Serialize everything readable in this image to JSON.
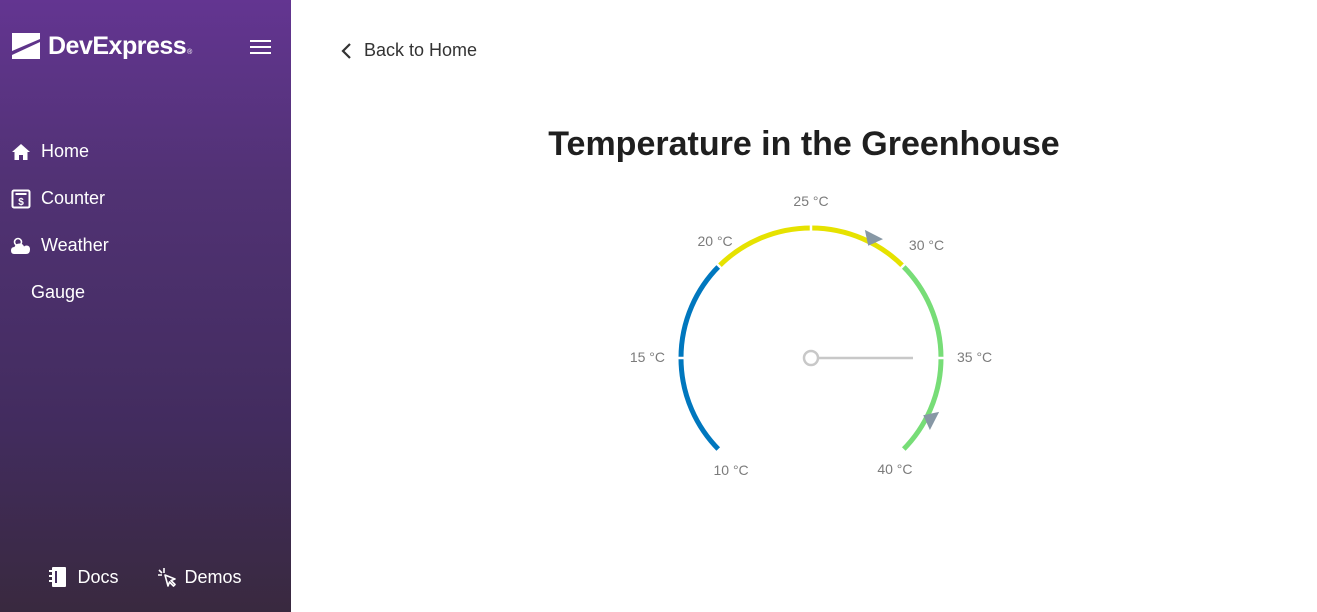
{
  "sidebar": {
    "brand": "DevExpress",
    "brand_mark": "®",
    "nav": [
      {
        "label": "Home",
        "icon": "home-icon"
      },
      {
        "label": "Counter",
        "icon": "counter-icon"
      },
      {
        "label": "Weather",
        "icon": "weather-icon"
      },
      {
        "label": "Gauge",
        "icon": ""
      }
    ],
    "footer": [
      {
        "label": "Docs",
        "icon": "docs-icon"
      },
      {
        "label": "Demos",
        "icon": "demos-icon"
      }
    ]
  },
  "main": {
    "back_label": "Back to Home",
    "title": "Temperature in the Greenhouse"
  },
  "gauge": {
    "min": 10,
    "max": 40,
    "value": 35,
    "subvalues": [
      28,
      38
    ],
    "ticks": [
      "10 °C",
      "15 °C",
      "20 °C",
      "25 °C",
      "30 °C",
      "35 °C",
      "40 °C"
    ],
    "ranges": [
      {
        "start": 10,
        "end": 20,
        "color": "#0077be"
      },
      {
        "start": 20,
        "end": 30,
        "color": "#e6e200"
      },
      {
        "start": 30,
        "end": 40,
        "color": "#77dd77"
      }
    ],
    "needle_color": "#c8c8c8",
    "subvalue_color": "#8798a5"
  }
}
